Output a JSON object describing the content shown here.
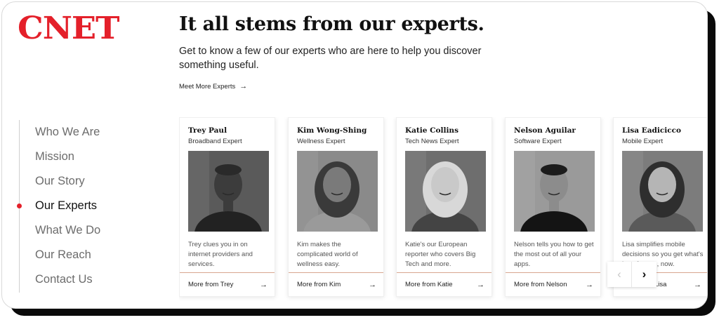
{
  "brand": {
    "logo_text": "CNET",
    "accent_color": "#e4202a"
  },
  "header": {
    "title": "It all stems from our experts.",
    "intro": "Get to know a few of our experts who are here to help you discover something useful.",
    "meet_more_label": "Meet More Experts",
    "arrow_icon": "→"
  },
  "side_nav": {
    "items": [
      {
        "label": "Who We Are",
        "active": false
      },
      {
        "label": "Mission",
        "active": false
      },
      {
        "label": "Our Story",
        "active": false
      },
      {
        "label": "Our Experts",
        "active": true
      },
      {
        "label": "What We Do",
        "active": false
      },
      {
        "label": "Our Reach",
        "active": false
      },
      {
        "label": "Contact Us",
        "active": false
      }
    ]
  },
  "experts": [
    {
      "name": "Trey Paul",
      "role": "Broadband Expert",
      "bio": "Trey clues you in on internet providers and services.",
      "more_label": "More from Trey"
    },
    {
      "name": "Kim Wong-Shing",
      "role": "Wellness Expert",
      "bio": "Kim makes the complicated world of wellness easy.",
      "more_label": "More from Kim"
    },
    {
      "name": "Katie Collins",
      "role": "Tech News Expert",
      "bio": "Katie's our European reporter who covers Big Tech and more.",
      "more_label": "More from Katie"
    },
    {
      "name": "Nelson Aguilar",
      "role": "Software Expert",
      "bio": "Nelson tells you how to get the most out of all your apps.",
      "more_label": "More from Nelson"
    },
    {
      "name": "Lisa Eadicicco",
      "role": "Mobile Expert",
      "bio": "Lisa simplifies mobile decisions so you get what's best for you, now.",
      "more_label": "More from Lisa"
    }
  ],
  "carousel": {
    "prev_icon": "‹",
    "next_icon": "›"
  }
}
